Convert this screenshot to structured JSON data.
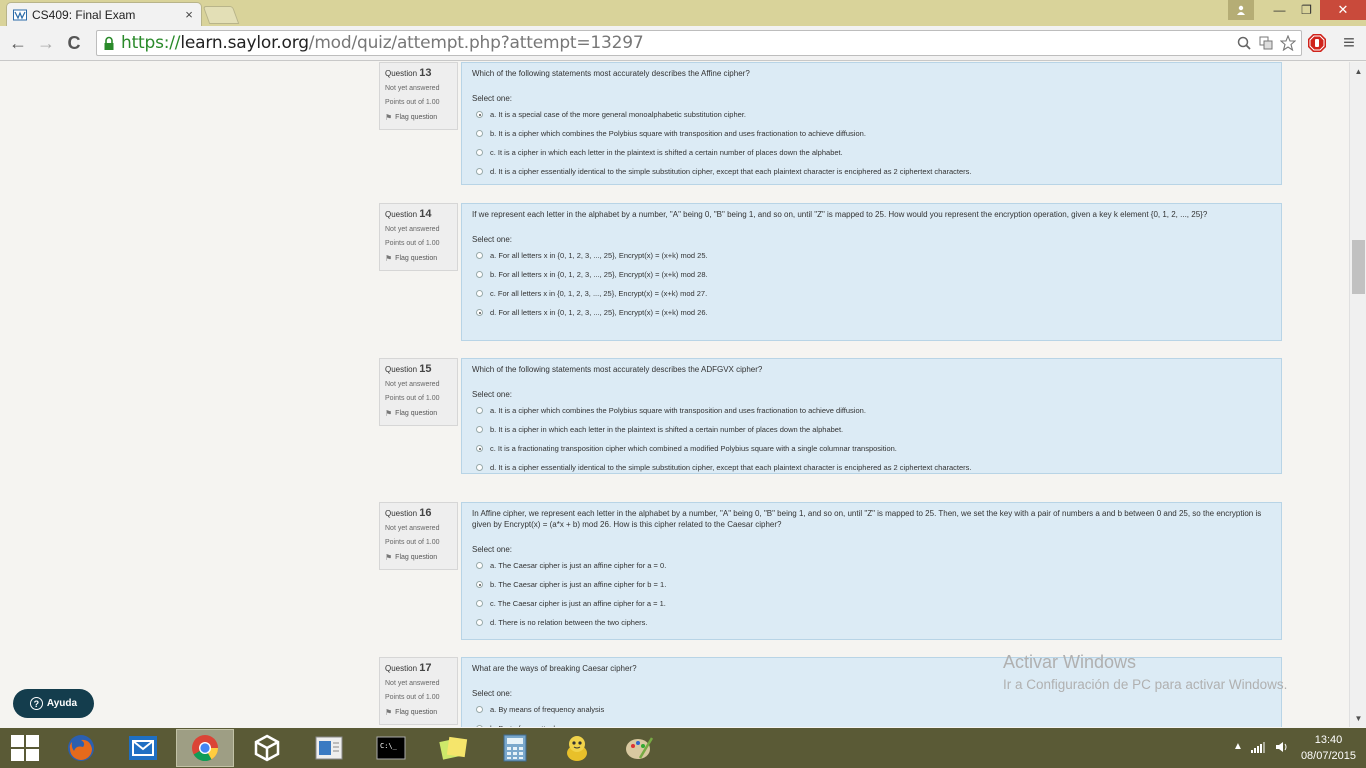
{
  "browser": {
    "tab_title": "CS409: Final Exam",
    "tab_close": "×",
    "url_scheme": "https://",
    "url_host": "learn.saylor.org",
    "url_path": "/mod/quiz/attempt.php?attempt=13297",
    "win_minimize": "—",
    "win_maximize": "❐",
    "win_close": "✕",
    "back": "←",
    "forward": "→",
    "reload": "C",
    "menu": "≡"
  },
  "questions": [
    {
      "label": "Question",
      "number": "13",
      "state": "Not yet answered",
      "grade": "Points out of 1.00",
      "flag": "Flag question",
      "text": "Which of the following statements most accurately describes the Affine cipher?",
      "prompt": "Select one:",
      "options": [
        {
          "label": "a. It is a special case of the more general monoalphabetic substitution cipher.",
          "checked": true
        },
        {
          "label": "b. It is a cipher which combines the Polybius square with transposition and uses fractionation to achieve diffusion.",
          "checked": false
        },
        {
          "label": "c. It is a cipher in which each letter in the plaintext is shifted a certain number of places down the alphabet.",
          "checked": false
        },
        {
          "label": "d. It is a cipher essentially identical to the simple substitution cipher, except that each plaintext character is enciphered as 2 ciphertext characters.",
          "checked": false
        }
      ]
    },
    {
      "label": "Question",
      "number": "14",
      "state": "Not yet answered",
      "grade": "Points out of 1.00",
      "flag": "Flag question",
      "text": "If we represent each letter in the alphabet by a number, \"A\" being 0, \"B\" being 1, and so on, until \"Z\" is mapped to 25. How would you represent the encryption operation, given a key k element {0, 1, 2, ..., 25}?",
      "prompt": "Select one:",
      "options": [
        {
          "label": "a. For all letters x in {0, 1, 2, 3, ..., 25}, Encrypt(x) = (x+k) mod 25.",
          "checked": false
        },
        {
          "label": "b. For all letters x in {0, 1, 2, 3, ..., 25}, Encrypt(x) = (x+k) mod 28.",
          "checked": false
        },
        {
          "label": "c. For all letters x in {0, 1, 2, 3, ..., 25}, Encrypt(x) = (x+k) mod 27.",
          "checked": false
        },
        {
          "label": "d. For all letters x in {0, 1, 2, 3, ..., 25}, Encrypt(x) = (x+k) mod 26.",
          "checked": true
        }
      ]
    },
    {
      "label": "Question",
      "number": "15",
      "state": "Not yet answered",
      "grade": "Points out of 1.00",
      "flag": "Flag question",
      "text": "Which of the following statements most accurately describes the ADFGVX cipher?",
      "prompt": "Select one:",
      "options": [
        {
          "label": "a. It is a cipher which combines the Polybius square with transposition and uses fractionation to achieve diffusion.",
          "checked": false
        },
        {
          "label": "b. It is a cipher in which each letter in the plaintext is shifted a certain number of places down the alphabet.",
          "checked": false
        },
        {
          "label": "c. It is a fractionating transposition cipher which combined a modified Polybius square with a single columnar transposition.",
          "checked": true
        },
        {
          "label": "d. It is a cipher essentially identical to the simple substitution cipher, except that each plaintext character is enciphered as 2 ciphertext characters.",
          "checked": false
        }
      ]
    },
    {
      "label": "Question",
      "number": "16",
      "state": "Not yet answered",
      "grade": "Points out of 1.00",
      "flag": "Flag question",
      "text": "In Affine cipher, we represent each letter in the alphabet by a number, \"A\" being 0, \"B\" being 1, and so on, until \"Z\" is mapped to 25. Then, we set the key with a pair of numbers a and b between 0 and 25, so the encryption is given by Encrypt(x) = (a*x + b) mod 26. How is this cipher related to the Caesar cipher?",
      "prompt": "Select one:",
      "options": [
        {
          "label": "a. The Caesar cipher is just an affine cipher for a = 0.",
          "checked": false
        },
        {
          "label": "b. The Caesar cipher is just an affine cipher for b = 1.",
          "checked": true
        },
        {
          "label": "c. The Caesar cipher is just an affine cipher for a = 1.",
          "checked": false
        },
        {
          "label": "d. There is no relation between the two ciphers.",
          "checked": false
        }
      ]
    },
    {
      "label": "Question",
      "number": "17",
      "state": "Not yet answered",
      "grade": "Points out of 1.00",
      "flag": "Flag question",
      "text": "What are the ways of breaking Caesar cipher?",
      "prompt": "Select one:",
      "options": [
        {
          "label": "a. By means of frequency analysis",
          "checked": false
        },
        {
          "label": "b. Brute force attack",
          "checked": false
        }
      ]
    }
  ],
  "help_button": "Ayuda",
  "watermark": {
    "title": "Activar Windows",
    "subtitle": "Ir a Configuración de PC para activar Windows."
  },
  "taskbar": {
    "time": "13:40",
    "date": "08/07/2015",
    "cmd_label": "C:\\_"
  },
  "colors": {
    "question_bg": "#dcebf5",
    "taskbar_bg": "#5a5a36",
    "titlebar_bg": "#d9d39a",
    "help_bg": "#143d4d"
  }
}
